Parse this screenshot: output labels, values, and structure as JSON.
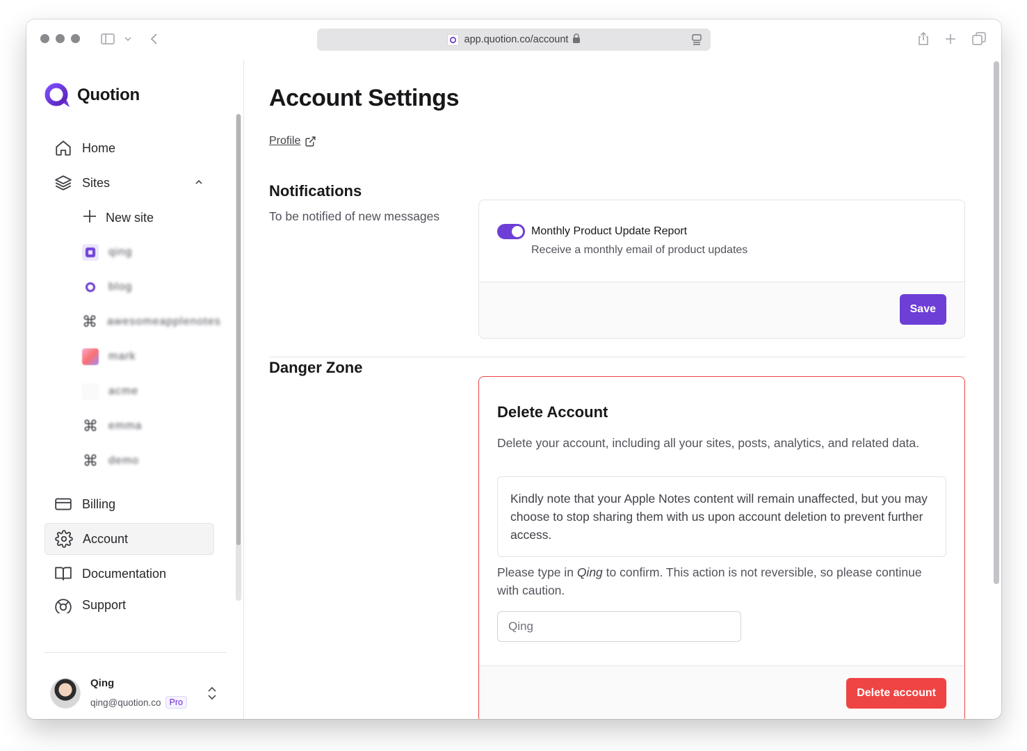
{
  "browser": {
    "url": "app.quotion.co/account"
  },
  "brand": {
    "name": "Quotion",
    "accent": "#6d3fd6",
    "danger": "#ef4444"
  },
  "sidebar": {
    "items": [
      {
        "label": "Home",
        "icon": "home-icon"
      },
      {
        "label": "Sites",
        "icon": "layers-icon"
      }
    ],
    "new_site_label": "New site",
    "sites": [
      {
        "name": "qing",
        "icon": "site-square-icon"
      },
      {
        "name": "blog",
        "icon": "site-logo-icon"
      },
      {
        "name": "awesomeapplenotes",
        "icon": "command-icon"
      },
      {
        "name": "mark",
        "icon": "site-gradient-icon"
      },
      {
        "name": "acme",
        "icon": "site-blank-icon"
      },
      {
        "name": "emma",
        "icon": "command-icon"
      },
      {
        "name": "demo",
        "icon": "command-icon"
      }
    ],
    "bottom_items": [
      {
        "label": "Billing",
        "icon": "credit-card-icon"
      },
      {
        "label": "Account",
        "icon": "gear-icon"
      },
      {
        "label": "Documentation",
        "icon": "book-icon"
      },
      {
        "label": "Support",
        "icon": "lifebuoy-icon"
      }
    ],
    "user": {
      "name": "Qing",
      "email": "qing@quotion.co",
      "plan": "Pro"
    }
  },
  "main": {
    "title": "Account Settings",
    "profile_link": "Profile",
    "notifications": {
      "title": "Notifications",
      "description": "To be notified of new messages",
      "option_title": "Monthly Product Update Report",
      "option_description": "Receive a monthly email of product updates",
      "toggle_on": true,
      "save_label": "Save"
    },
    "danger_zone": {
      "title": "Danger Zone",
      "card_title": "Delete Account",
      "description": "Delete your account, including all your sites, posts, analytics, and related data.",
      "note": "Kindly note that your Apple Notes content will remain unaffected, but you may choose to stop sharing them with us upon account deletion to prevent further access.",
      "confirm_prefix": "Please type in",
      "confirm_name": "Qing",
      "confirm_suffix": "to confirm. This action is not reversible, so please continue with caution.",
      "input_placeholder": "Qing",
      "delete_label": "Delete account"
    }
  }
}
